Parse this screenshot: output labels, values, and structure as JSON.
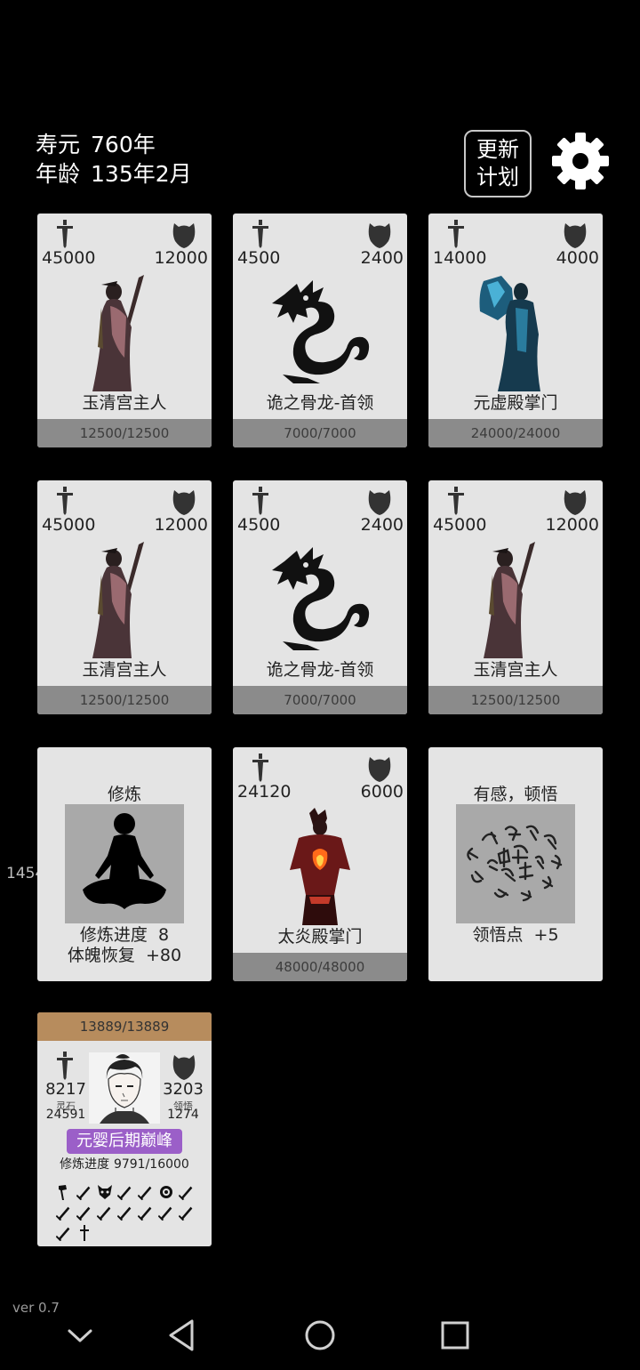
{
  "status": {
    "lifespan_label": "寿元",
    "lifespan_value": "760年",
    "age_label": "年龄",
    "age_value": "135年2月"
  },
  "header": {
    "plan_button_line1": "更新",
    "plan_button_line2": "计划",
    "settings_icon": "gear-icon"
  },
  "enemies": [
    {
      "attack": "45000",
      "defense": "12000",
      "name": "玉清宫主人",
      "hp": "12500/12500",
      "portrait": "robed-sorcerer"
    },
    {
      "attack": "4500",
      "defense": "2400",
      "name": "诡之骨龙-首领",
      "hp": "7000/7000",
      "portrait": "dragon"
    },
    {
      "attack": "14000",
      "defense": "4000",
      "name": "元虚殿掌门",
      "hp": "24000/24000",
      "portrait": "blue-robed-master"
    },
    {
      "attack": "45000",
      "defense": "12000",
      "name": "玉清宫主人",
      "hp": "12500/12500",
      "portrait": "robed-sorcerer"
    },
    {
      "attack": "4500",
      "defense": "2400",
      "name": "诡之骨龙-首领",
      "hp": "7000/7000",
      "portrait": "dragon"
    },
    {
      "attack": "45000",
      "defense": "12000",
      "name": "玉清宫主人",
      "hp": "12500/12500",
      "portrait": "robed-sorcerer"
    },
    {
      "attack": "24120",
      "defense": "6000",
      "name": "太炎殿掌门",
      "hp": "48000/48000",
      "portrait": "fire-master"
    }
  ],
  "cultivate_card": {
    "title": "修炼",
    "progress_label": "修炼进度",
    "progress_value": "8",
    "recover_label": "体魄恢复",
    "recover_value": "+80",
    "side_number": "1454"
  },
  "insight_card": {
    "title": "有感，顿悟",
    "points_label": "领悟点",
    "points_value": "+5"
  },
  "player": {
    "hp": "13889/13889",
    "attack": "8217",
    "defense": "3203",
    "spirit_stone_label": "灵石",
    "spirit_stone_value": "24591",
    "insight_label": "领悟",
    "insight_value": "1274",
    "realm": "元婴后期巅峰",
    "cultivation_label": "修炼进度",
    "cultivation_value": "9791/16000",
    "items": [
      "axe-icon",
      "sword-icon",
      "demon-mask-icon",
      "sword-icon",
      "sword-icon",
      "demon-face-icon",
      "sword-icon",
      "sword-icon",
      "sword-icon",
      "sword-icon",
      "sword-icon",
      "sword-icon",
      "sword-icon",
      "sword-icon",
      "sword-icon",
      "dagger-icon"
    ]
  },
  "footer": {
    "version": "ver 0.7"
  },
  "colors": {
    "background": "#000000",
    "card": "#e4e4e4",
    "hp_bar": "#8b8b8b",
    "player_hp_bar": "#b78c5d",
    "realm_badge": "#9b5fc8"
  }
}
